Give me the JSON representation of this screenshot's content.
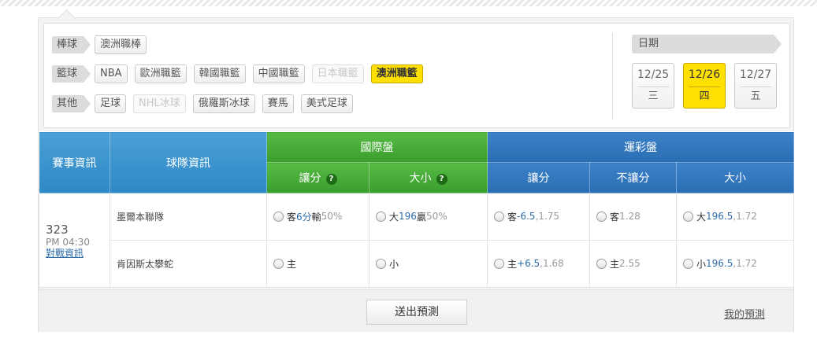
{
  "filters": {
    "baseball": {
      "label": "棒球",
      "items": [
        {
          "label": "澳洲職棒",
          "state": "normal"
        }
      ]
    },
    "basketball": {
      "label": "籃球",
      "items": [
        {
          "label": "NBA",
          "state": "normal"
        },
        {
          "label": "歐洲職籃",
          "state": "normal"
        },
        {
          "label": "韓國職籃",
          "state": "normal"
        },
        {
          "label": "中國職籃",
          "state": "normal"
        },
        {
          "label": "日本職籃",
          "state": "disabled"
        },
        {
          "label": "澳洲職籃",
          "state": "active"
        }
      ]
    },
    "other": {
      "label": "其他",
      "items": [
        {
          "label": "足球",
          "state": "normal"
        },
        {
          "label": "NHL冰球",
          "state": "disabled"
        },
        {
          "label": "俄羅斯冰球",
          "state": "normal"
        },
        {
          "label": "賽馬",
          "state": "normal"
        },
        {
          "label": "美式足球",
          "state": "normal"
        }
      ]
    }
  },
  "dates": {
    "label": "日期",
    "items": [
      {
        "date": "12/25",
        "weekday": "三",
        "active": false
      },
      {
        "date": "12/26",
        "weekday": "四",
        "active": true
      },
      {
        "date": "12/27",
        "weekday": "五",
        "active": false
      }
    ]
  },
  "table": {
    "headers": {
      "game_info": "賽事資訊",
      "team_info": "球隊資訊",
      "intl": "國際盤",
      "intl_handicap": "讓分",
      "intl_total": "大小",
      "lottery": "運彩盤",
      "lot_handicap": "讓分",
      "lot_moneyline": "不讓分",
      "lot_total": "大小",
      "help_icon": "?"
    },
    "game": {
      "id": "323",
      "time": "PM 04:30",
      "link": "對戰資訊",
      "away": {
        "team": "墨爾本聯隊",
        "intl_handicap": {
          "side": "客",
          "line": "6分",
          "result": "輸",
          "pct": "50%"
        },
        "intl_total": {
          "side": "大",
          "line": "196",
          "result": "贏",
          "pct": "50%"
        },
        "lot_handicap": {
          "side": "客",
          "line": "-6.5",
          "sep": ", ",
          "odds": "1.75"
        },
        "lot_moneyline": {
          "side": "客",
          "odds": "1.28"
        },
        "lot_total": {
          "side": "大",
          "line": "196.5",
          "sep": ", ",
          "odds": "1.72"
        }
      },
      "home": {
        "team": "肯因斯太攀蛇",
        "intl_handicap": {
          "side": "主"
        },
        "intl_total": {
          "side": "小"
        },
        "lot_handicap": {
          "side": "主",
          "line": "+6.5",
          "sep": ", ",
          "odds": "1.68"
        },
        "lot_moneyline": {
          "side": "主",
          "odds": "2.55"
        },
        "lot_total": {
          "side": "小",
          "line": "196.5",
          "sep": ", ",
          "odds": "1.72"
        }
      }
    }
  },
  "footer": {
    "submit": "送出預測",
    "my_predictions": "我的預測"
  }
}
